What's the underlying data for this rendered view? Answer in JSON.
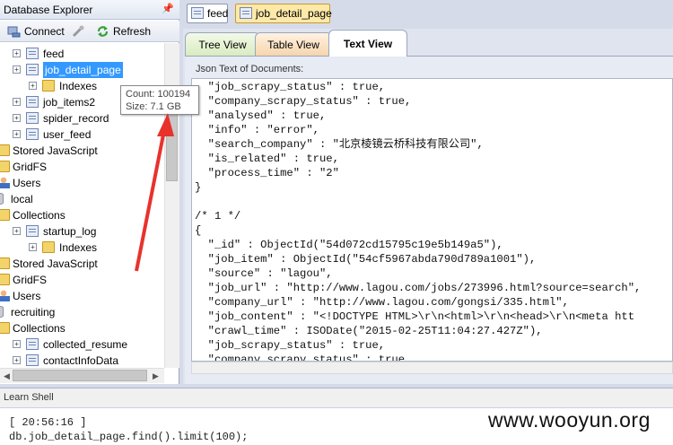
{
  "explorer": {
    "title": "Database Explorer",
    "connect_label": "Connect",
    "refresh_label": "Refresh",
    "tree": [
      {
        "label": "feed",
        "type": "collection",
        "indent": 1
      },
      {
        "label": "job_detail_page",
        "type": "collection",
        "indent": 1,
        "selected": true
      },
      {
        "label": "Indexes",
        "type": "folder",
        "indent": 2
      },
      {
        "label": "job_items2",
        "type": "collection",
        "indent": 1
      },
      {
        "label": "spider_record",
        "type": "collection",
        "indent": 1
      },
      {
        "label": "user_feed",
        "type": "collection",
        "indent": 1
      },
      {
        "label": "Stored JavaScript",
        "type": "folder",
        "indent": 0
      },
      {
        "label": "GridFS",
        "type": "folder",
        "indent": 0
      },
      {
        "label": "Users",
        "type": "user",
        "indent": 0
      },
      {
        "label": "local",
        "type": "db",
        "indent": -1
      },
      {
        "label": "Collections",
        "type": "folder",
        "indent": 0
      },
      {
        "label": "startup_log",
        "type": "collection",
        "indent": 1
      },
      {
        "label": "Indexes",
        "type": "folder",
        "indent": 2
      },
      {
        "label": "Stored JavaScript",
        "type": "folder",
        "indent": 0
      },
      {
        "label": "GridFS",
        "type": "folder",
        "indent": 0
      },
      {
        "label": "Users",
        "type": "user",
        "indent": 0
      },
      {
        "label": "recruiting",
        "type": "db",
        "indent": -1
      },
      {
        "label": "Collections",
        "type": "folder",
        "indent": 0
      },
      {
        "label": "collected_resume",
        "type": "collection",
        "indent": 1
      },
      {
        "label": "contactInfoData",
        "type": "collection",
        "indent": 1
      }
    ]
  },
  "tooltip": {
    "count": "Count: 100194",
    "size": "Size: 7.1 GB"
  },
  "doc_tabs": [
    {
      "label": "feed",
      "active": false
    },
    {
      "label": "job_detail_page",
      "active": true
    }
  ],
  "view_tabs": {
    "tree": "Tree View",
    "table": "Table View",
    "text": "Text View"
  },
  "json_label": "Json Text of Documents:",
  "json_lines": [
    "  \"job_scrapy_status\" : true,",
    "  \"company_scrapy_status\" : true,",
    "  \"analysed\" : true,",
    "  \"info\" : \"error\",",
    "  \"search_company\" : \"北京棱镜云桥科技有限公司\",",
    "  \"is_related\" : true,",
    "  \"process_time\" : \"2\"",
    "}",
    "",
    "/* 1 */",
    "{",
    "  \"_id\" : ObjectId(\"54d072cd15795c19e5b149a5\"),",
    "  \"job_item\" : ObjectId(\"54cf5967abda790d789a1001\"),",
    "  \"source\" : \"lagou\",",
    "  \"job_url\" : \"http://www.lagou.com/jobs/273996.html?source=search\",",
    "  \"company_url\" : \"http://www.lagou.com/gongsi/335.html\",",
    "  \"job_content\" : \"<!DOCTYPE HTML>\\r\\n<html>\\r\\n<head>\\r\\n<meta htt",
    "  \"crawl_time\" : ISODate(\"2015-02-25T11:04:27.427Z\"),",
    "  \"job_scrapy_status\" : true,",
    "  \"company_scrapy_status\" : true"
  ],
  "shell": {
    "title": "Learn Shell",
    "time_line": "[ 20:56:16 ]",
    "command_line": "db.job_detail_page.find().limit(100);"
  },
  "watermark": "www.wooyun.org",
  "colors": {
    "selection": "#3399ff",
    "arrow": "#e8322c",
    "active_tab": "#fde9a8"
  }
}
